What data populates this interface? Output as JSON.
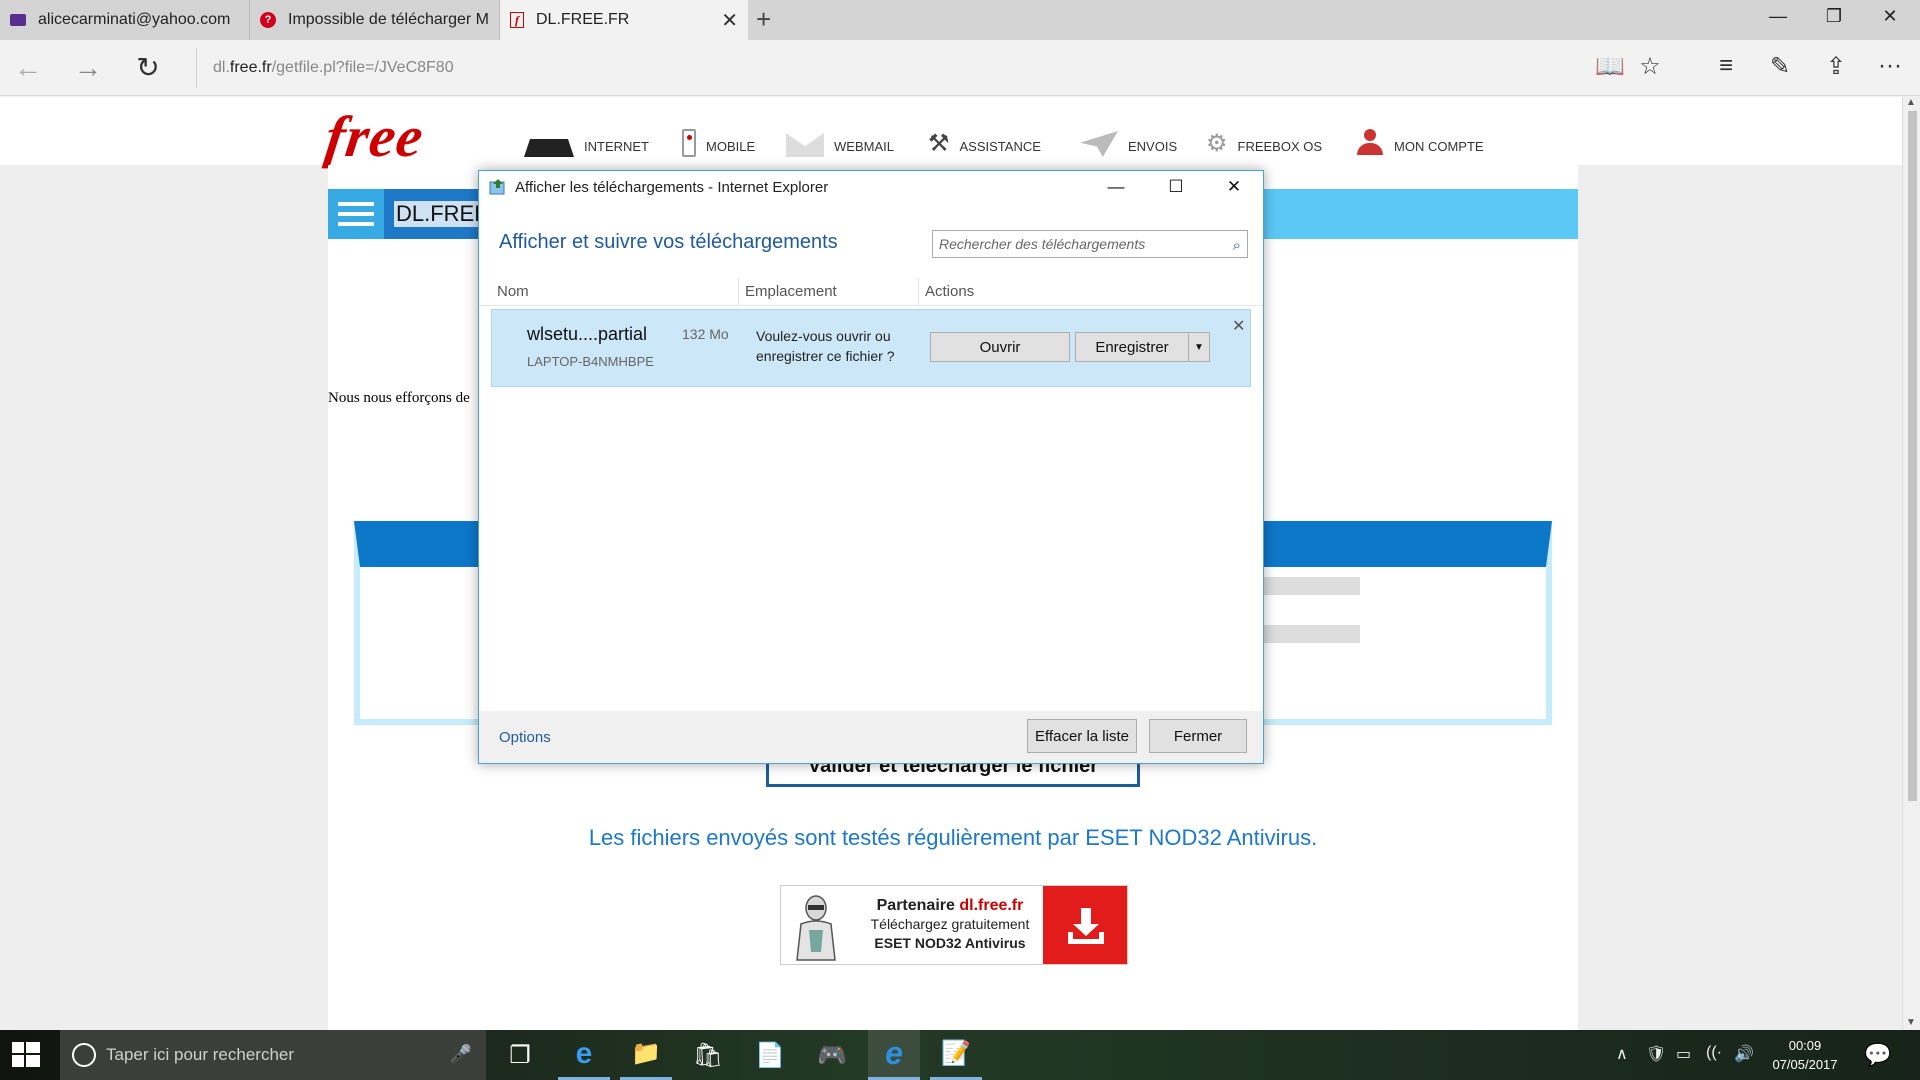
{
  "browser": {
    "tabs": [
      {
        "title": "alicecarminati@yahoo.com",
        "icon": "mail-icon",
        "state": "inactive"
      },
      {
        "title": "Impossible de télécharger M",
        "icon": "help-icon",
        "state": "inactive"
      },
      {
        "title": "DL.FREE.FR",
        "icon": "free-favicon",
        "state": "active",
        "close": "✕"
      }
    ],
    "new_tab": "+",
    "window_controls": {
      "minimize": "—",
      "maximize": "❐",
      "close": "✕"
    },
    "nav": {
      "back": "←",
      "forward": "→",
      "refresh": "↻"
    },
    "address": {
      "domain_prefix": "dl.",
      "domain": "free.fr",
      "path": "/getfile.pl?file=/JVeC8F80"
    },
    "tools": {
      "reading_view": "📖",
      "favorite": "☆",
      "hub": "≡",
      "note": "✎",
      "share": "⇪",
      "more": "···"
    }
  },
  "site": {
    "logo": "free",
    "menu": [
      {
        "label": "INTERNET",
        "icon": "freebox-icon"
      },
      {
        "label": "MOBILE",
        "icon": "mobile-icon"
      },
      {
        "label": "WEBMAIL",
        "icon": "envelope-icon"
      },
      {
        "label": "ASSISTANCE",
        "icon": "tools-icon"
      },
      {
        "label": "ENVOIS",
        "icon": "paper-plane-icon"
      },
      {
        "label": "FREEBOX OS",
        "icon": "gear-icon"
      },
      {
        "label": "MON COMPTE",
        "icon": "user-icon"
      }
    ],
    "dl_title": "DL.FREE",
    "intro_text": "Nous nous efforçons de",
    "submit_label": "Valider et télécharger le fichier",
    "eset_notice": "Les fichiers envoyés sont testés régulièrement par ESET NOD32 Antivirus.",
    "partner": {
      "line1_prefix": "Partenaire ",
      "line1_brand": "dl.free.fr",
      "line2": "Téléchargez gratuitement",
      "line3": "ESET NOD32 Antivirus"
    }
  },
  "dialog": {
    "title": "Afficher les téléchargements - Internet Explorer",
    "heading": "Afficher et suivre vos téléchargements",
    "search_placeholder": "Rechercher des téléchargements",
    "columns": [
      "Nom",
      "Emplacement",
      "Actions"
    ],
    "download": {
      "name": "wlsetu....partial",
      "size": "132 Mo",
      "host": "LAPTOP-B4NMHBPE",
      "question": "Voulez-vous ouvrir ou enregistrer ce fichier ?",
      "open_label": "Ouvrir",
      "save_label": "Enregistrer",
      "save_arrow": "▼",
      "dismiss": "✕"
    },
    "options_label": "Options",
    "clear_label": "Effacer la liste",
    "close_label": "Fermer",
    "controls": {
      "minimize": "—",
      "maximize": "☐",
      "close": "✕"
    }
  },
  "taskbar": {
    "search_placeholder": "Taper ici pour rechercher",
    "mic": "🎤",
    "apps": [
      {
        "name": "task-view-icon",
        "glyph": "❐",
        "state": "normal"
      },
      {
        "name": "edge-icon",
        "glyph": "e",
        "state": "open"
      },
      {
        "name": "file-explorer-icon",
        "glyph": "📁",
        "state": "open"
      },
      {
        "name": "store-icon",
        "glyph": "🛍",
        "state": "normal"
      },
      {
        "name": "document-icon",
        "glyph": "📄",
        "state": "normal"
      },
      {
        "name": "game-icon",
        "glyph": "🎮",
        "state": "normal"
      },
      {
        "name": "internet-explorer-icon",
        "glyph": "e",
        "state": "focus"
      },
      {
        "name": "notepad-icon",
        "glyph": "📝",
        "state": "open"
      }
    ],
    "tray": {
      "chevron": "∧",
      "shield": "🛡",
      "battery": "▭",
      "wifi": "((·",
      "volume": "🔊"
    },
    "time": "00:09",
    "date": "07/05/2017",
    "notification": "💬"
  },
  "colors": {
    "accent_blue": "#1e78c8",
    "light_blue": "#5bc8f5",
    "free_red": "#cc0000",
    "selection": "#cce8f8"
  }
}
